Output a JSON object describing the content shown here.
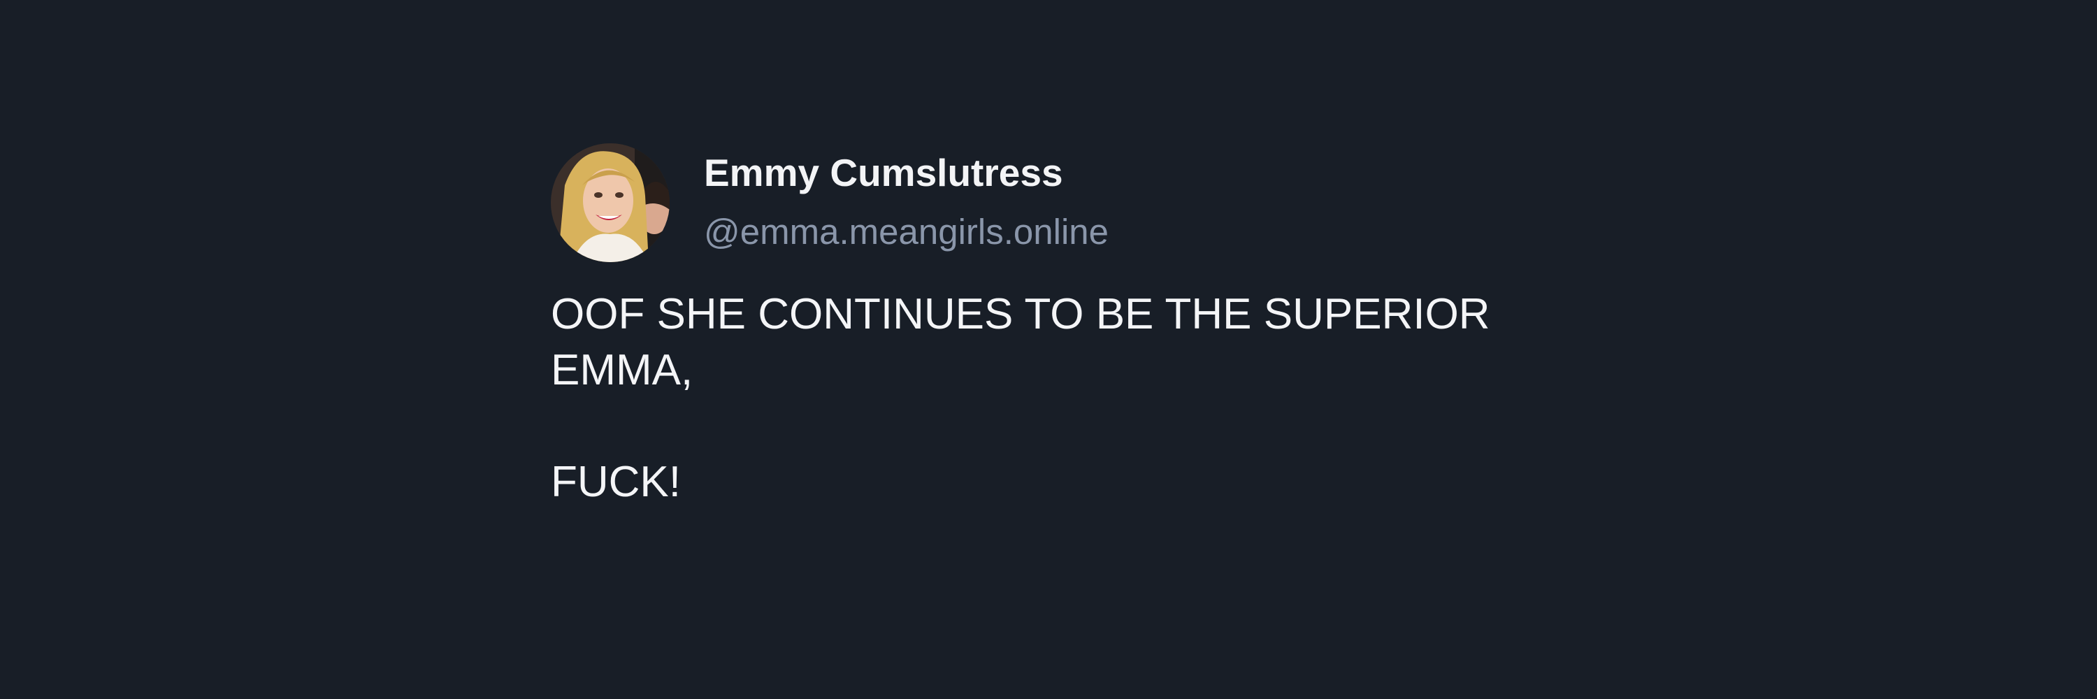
{
  "post": {
    "author": {
      "display_name": "Emmy Cumslutress",
      "handle": "@emma.meangirls.online",
      "avatar_icon": "profile-photo-avatar"
    },
    "lines": [
      "OOF SHE CONTINUES TO BE THE SUPERIOR EMMA,",
      "FUCK!"
    ]
  },
  "colors": {
    "background": "#181e27",
    "text_primary": "#f3f4f6",
    "text_secondary": "#8a96aa"
  }
}
